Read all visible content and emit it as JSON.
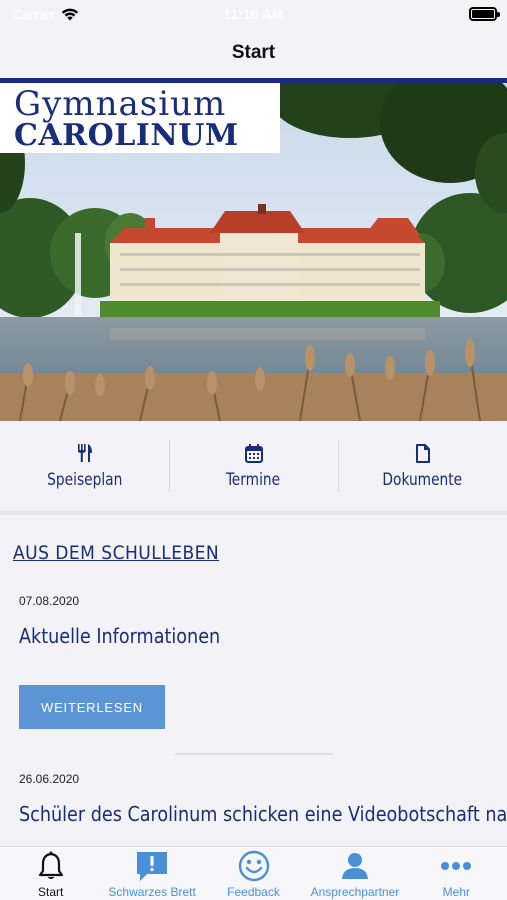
{
  "status_bar": {
    "carrier": "Carrier",
    "time": "11:16 AM",
    "battery_level": 1.0
  },
  "nav": {
    "title": "Start"
  },
  "hero": {
    "logo_line1": "Gymnasium",
    "logo_line2": "CAROLINUM"
  },
  "quick_links": [
    {
      "label": "Speiseplan",
      "icon": "cutlery-icon"
    },
    {
      "label": "Termine",
      "icon": "calendar-icon"
    },
    {
      "label": "Dokumente",
      "icon": "document-icon"
    }
  ],
  "news": {
    "section_title": "AUS DEM SCHULLEBEN",
    "items": [
      {
        "date": "07.08.2020",
        "title": "Aktuelle Informationen",
        "button": "WEITERLESEN"
      },
      {
        "date": "26.06.2020",
        "title": "Schüler des Carolinum schicken eine Videobotschaft nach Bülach"
      }
    ]
  },
  "tab_bar": {
    "active": "Start",
    "tabs": [
      {
        "label": "Start",
        "icon": "bell-icon"
      },
      {
        "label": "Schwarzes Brett",
        "icon": "exclamation-bubble-icon"
      },
      {
        "label": "Feedback",
        "icon": "smiley-icon"
      },
      {
        "label": "Ansprechpartner",
        "icon": "person-icon"
      },
      {
        "label": "Mehr",
        "icon": "more-dots-icon"
      }
    ]
  },
  "colors": {
    "accent_navy": "#1a2d78",
    "button_blue": "#5b95d6",
    "tab_blue": "#4a8fd8",
    "background": "#f2f2f7"
  }
}
